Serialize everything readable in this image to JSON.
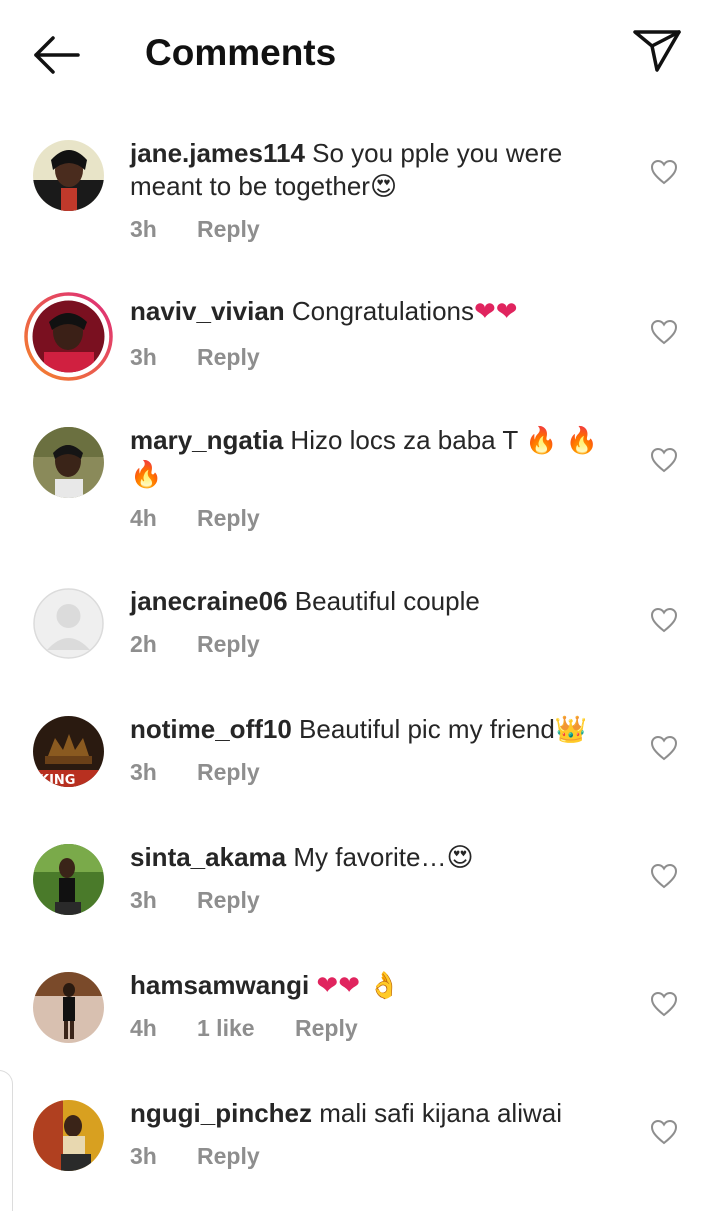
{
  "header": {
    "title": "Comments"
  },
  "icons": {
    "back": "arrow-left-icon",
    "share": "paper-plane-icon",
    "like": "heart-outline-icon"
  },
  "colors": {
    "meta_text": "#8e8e8e",
    "story_ring_start": "#f58529",
    "story_ring_end": "#dd2a7b",
    "heart": "#e0245e"
  },
  "comments": [
    {
      "username": "jane.james114",
      "text": "So you pple you were meant to be together",
      "emoji": "😍",
      "time": "3h",
      "likes": "",
      "reply_label": "Reply"
    },
    {
      "username": "naviv_vivian",
      "text": "Congratulations",
      "emoji": "❤❤",
      "time": "3h",
      "likes": "",
      "reply_label": "Reply"
    },
    {
      "username": "mary_ngatia",
      "text": "Hizo locs za baba T",
      "emoji": "🔥 🔥 🔥",
      "time": "4h",
      "likes": "",
      "reply_label": "Reply"
    },
    {
      "username": "janecraine06",
      "text": "Beautiful couple",
      "emoji": "",
      "time": "2h",
      "likes": "",
      "reply_label": "Reply"
    },
    {
      "username": "notime_off10",
      "text": "Beautiful pic my friend",
      "emoji": "👑",
      "time": "3h",
      "likes": "",
      "reply_label": "Reply"
    },
    {
      "username": "sinta_akama",
      "text": "My favorite…",
      "emoji": "😍",
      "time": "3h",
      "likes": "",
      "reply_label": "Reply"
    },
    {
      "username": "hamsamwangi",
      "text": "",
      "emoji": "❤❤ 👌",
      "time": "4h",
      "likes": "1 like",
      "reply_label": "Reply"
    },
    {
      "username": "ngugi_pinchez",
      "text": "mali safi kijana aliwai",
      "emoji": "",
      "time": "3h",
      "likes": "",
      "reply_label": "Reply"
    }
  ]
}
